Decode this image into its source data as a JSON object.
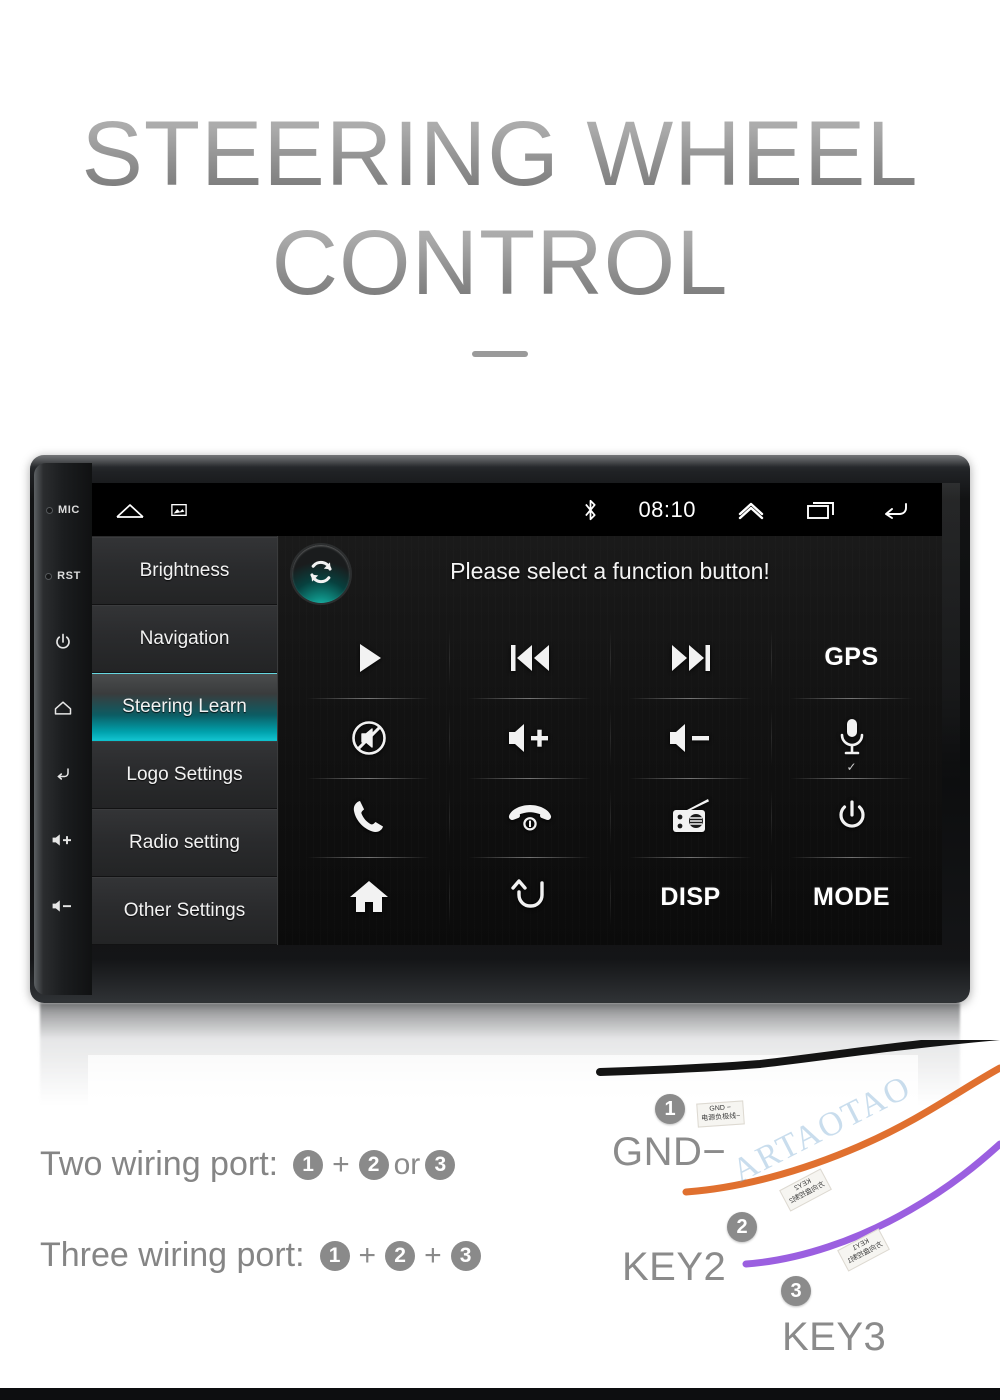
{
  "title": {
    "line1": "STEERING WHEEL",
    "line2": "CONTROL"
  },
  "device": {
    "bezel_buttons": [
      {
        "name": "mic",
        "label": "MIC",
        "icon": "mic-hole-icon"
      },
      {
        "name": "reset",
        "label": "RST",
        "icon": "reset-hole-icon"
      },
      {
        "name": "power",
        "label": "",
        "icon": "power-icon"
      },
      {
        "name": "home",
        "label": "",
        "icon": "home-icon"
      },
      {
        "name": "back",
        "label": "",
        "icon": "back-icon"
      },
      {
        "name": "volume-up",
        "label": "+",
        "icon": "speaker-plus-icon"
      },
      {
        "name": "volume-down",
        "label": "-",
        "icon": "speaker-minus-icon"
      }
    ],
    "statusbar": {
      "home_icon": "home-outline-icon",
      "screenshot_icon": "image-icon",
      "bluetooth_icon": "bluetooth-icon",
      "time": "08:10",
      "chevron_icon": "chevron-up-icon",
      "recents_icon": "recents-icon",
      "back_icon": "back-arrow-icon"
    },
    "sidebar": {
      "items": [
        {
          "label": "Brightness",
          "selected": false
        },
        {
          "label": "Navigation",
          "selected": false
        },
        {
          "label": "Steering Learn",
          "selected": true
        },
        {
          "label": "Logo Settings",
          "selected": false
        },
        {
          "label": "Radio setting",
          "selected": false
        },
        {
          "label": "Other Settings",
          "selected": false
        }
      ]
    },
    "panel": {
      "refresh_icon": "refresh-icon",
      "message": "Please select a function button!",
      "buttons": [
        {
          "name": "play",
          "type": "icon",
          "icon": "play-icon",
          "label": ""
        },
        {
          "name": "previous",
          "type": "icon",
          "icon": "previous-track-icon",
          "label": ""
        },
        {
          "name": "next",
          "type": "icon",
          "icon": "next-track-icon",
          "label": ""
        },
        {
          "name": "gps",
          "type": "text",
          "icon": "",
          "label": "GPS"
        },
        {
          "name": "mute",
          "type": "icon",
          "icon": "mute-icon",
          "label": ""
        },
        {
          "name": "volume-up",
          "type": "icon",
          "icon": "volume-up-icon",
          "label": ""
        },
        {
          "name": "volume-down",
          "type": "icon",
          "icon": "volume-down-icon",
          "label": ""
        },
        {
          "name": "voice",
          "type": "icon",
          "icon": "microphone-icon",
          "label": "",
          "check": "✓"
        },
        {
          "name": "call-answer",
          "type": "icon",
          "icon": "phone-icon",
          "label": ""
        },
        {
          "name": "call-end",
          "type": "icon",
          "icon": "phone-hangup-icon",
          "label": ""
        },
        {
          "name": "radio",
          "type": "icon",
          "icon": "radio-icon",
          "label": ""
        },
        {
          "name": "power",
          "type": "icon",
          "icon": "power-icon",
          "label": ""
        },
        {
          "name": "home",
          "type": "icon",
          "icon": "home-solid-icon",
          "label": ""
        },
        {
          "name": "back",
          "type": "icon",
          "icon": "back-curve-icon",
          "label": ""
        },
        {
          "name": "disp",
          "type": "text",
          "icon": "",
          "label": "DISP"
        },
        {
          "name": "mode",
          "type": "text",
          "icon": "",
          "label": "MODE"
        }
      ]
    }
  },
  "wiring": {
    "lines": [
      {
        "label": "Two wiring port:",
        "badge_a": "1",
        "op1": "+",
        "badge_b": "2",
        "op2": "or",
        "badge_c": "3"
      },
      {
        "label": "Three wiring port:",
        "badge_a": "1",
        "op1": "+",
        "badge_b": "2",
        "op2": "+",
        "badge_c": "3"
      }
    ],
    "wires": [
      {
        "badge": "1",
        "label": "GND−",
        "tag_top": "GND −",
        "tag_bottom": "电源负极线−",
        "color": "#121212"
      },
      {
        "badge": "2",
        "label": "KEY2",
        "tag_top": "KEY2",
        "tag_bottom": "方向盘控制2",
        "color": "#e0702f"
      },
      {
        "badge": "3",
        "label": "KEY3",
        "tag_top": "KEY1",
        "tag_bottom": "方向盘控制1",
        "color": "#9b5fe0"
      }
    ],
    "watermark": "ARTAOTAO"
  },
  "colors": {
    "accent_teal": "#00a2ad",
    "title_gray": "#8d8d8d",
    "badge_gray": "#8a8a8a"
  }
}
